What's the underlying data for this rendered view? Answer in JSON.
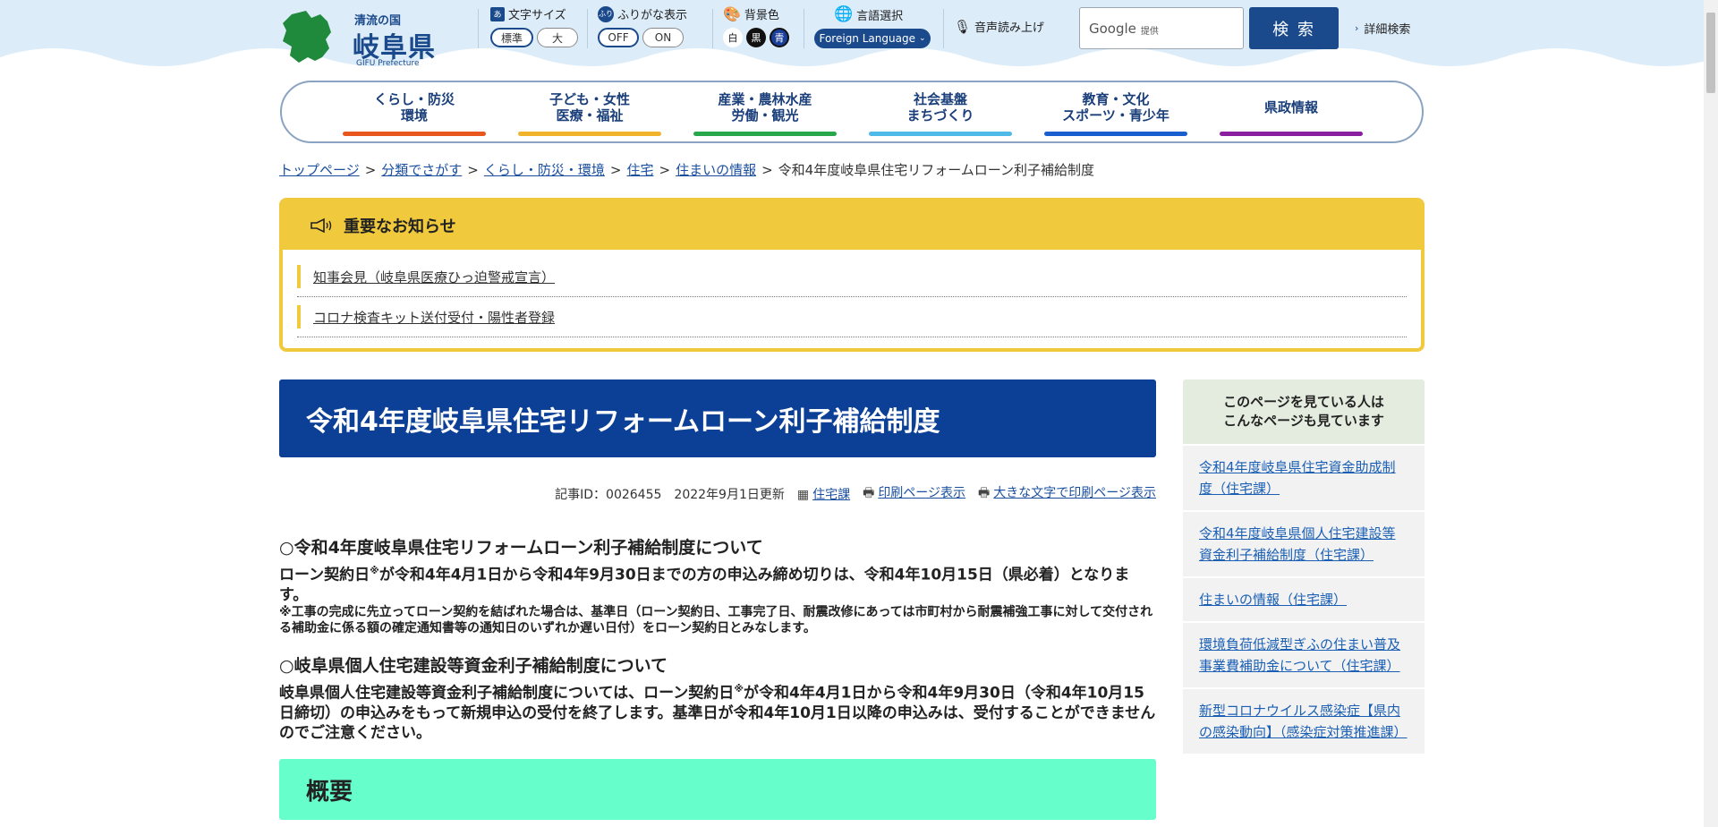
{
  "header": {
    "logo": {
      "small": "清流の国",
      "big": "岐阜県",
      "en": "GIFU Prefecture"
    },
    "font_size": {
      "label": "文字サイズ",
      "options": [
        "標準",
        "大"
      ],
      "selected": "標準"
    },
    "furigana": {
      "label": "ふりがな表示",
      "options": [
        "OFF",
        "ON"
      ],
      "selected": "OFF"
    },
    "bg_color": {
      "label": "背景色",
      "options": [
        "白",
        "黒",
        "青"
      ]
    },
    "language": {
      "label": "言語選択",
      "button": "Foreign Language"
    },
    "voice": {
      "label": "音声読み上げ"
    },
    "search": {
      "provider": "Google",
      "provider_sub": "提供",
      "button": "検 索",
      "advanced": "詳細検索"
    }
  },
  "nav": [
    {
      "label": "くらし・防災\n環境",
      "color": "#e8581e"
    },
    {
      "label": "子ども・女性\n医療・福祉",
      "color": "#f0b32b"
    },
    {
      "label": "産業・農林水産\n労働・観光",
      "color": "#28a84a"
    },
    {
      "label": "社会基盤\nまちづくり",
      "color": "#4fb9e8"
    },
    {
      "label": "教育・文化\nスポーツ・青少年",
      "color": "#1a5fd0"
    },
    {
      "label": "県政情報",
      "color": "#8a1fa0"
    }
  ],
  "breadcrumb": {
    "items": [
      "トップページ",
      "分類でさがす",
      "くらし・防災・環境",
      "住宅",
      "住まいの情報"
    ],
    "current": "令和4年度岐阜県住宅リフォームローン利子補給制度",
    "sep": ">"
  },
  "notice": {
    "title": "重要なお知らせ",
    "items": [
      "知事会見（岐阜県医療ひっ迫警戒宣言）",
      "コロナ検査キット送付受付・陽性者登録"
    ]
  },
  "main": {
    "title": "令和4年度岐阜県住宅リフォームローン利子補給制度",
    "meta": {
      "article_id": "記事ID：0026455",
      "updated": "2022年9月1日更新",
      "dept": "住宅課",
      "print": "印刷ページ表示",
      "print_large": "大きな文字で印刷ページ表示"
    },
    "section1": {
      "heading": "○令和4年度岐阜県住宅リフォームローン利子補給制度について",
      "p1a": "ローン契約日",
      "p1sup": "※",
      "p1b": "が令和4年4月1日から令和4年9月30日までの方の申込み締め切りは、令和4年10月15日（県必着）となります。",
      "note": "※工事の完成に先立ってローン契約を結ばれた場合は、基準日（ローン契約日、工事完了日、耐震改修にあっては市町村から耐震補強工事に対して交付される補助金に係る額の確定通知書等の通知日のいずれか遅い日付）をローン契約日とみなします。"
    },
    "section2": {
      "heading": "○岐阜県個人住宅建設等資金利子補給制度について",
      "p1a": "岐阜県個人住宅建設等資金利子補給制度については、ローン契約日",
      "p1sup": "※",
      "p1b": "が令和4年4月1日から令和4年9月30日（令和4年10月15日締切）の申込みをもって新規申込の受付を終了します。基準日が令和4年10月1日以降の申込みは、受付することができませんのでご注意ください。"
    },
    "overview": "概要"
  },
  "sidebar": {
    "heading": "このページを見ている人は\nこんなページも見ています",
    "items": [
      "令和4年度岐阜県住宅資金助成制度（住宅課）",
      "令和4年度岐阜県個人住宅建設等資金利子補給制度（住宅課）",
      "住まいの情報（住宅課）",
      "環境負荷低減型ぎふの住まい普及事業費補助金について（住宅課）",
      "新型コロナウイルス感染症【県内の感染動向】（感染症対策推進課）"
    ]
  }
}
